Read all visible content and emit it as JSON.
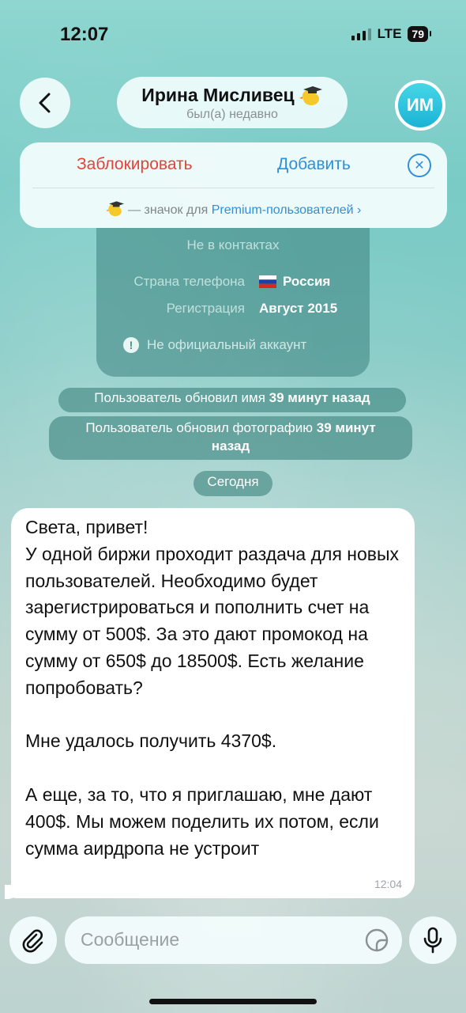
{
  "status": {
    "time": "12:07",
    "network": "LTE",
    "battery": "79"
  },
  "header": {
    "name": "Ирина Мисливец",
    "last_seen": "был(а) недавно",
    "avatar_initials": "ИМ"
  },
  "actions": {
    "block": "Заблокировать",
    "add": "Добавить",
    "premium_prefix": "— значок для",
    "premium_link": "Premium-пользователей ›"
  },
  "info_card": {
    "not_in_contacts": "Не в контактах",
    "phone_country_label": "Страна телефона",
    "phone_country_value": "Россия",
    "registration_label": "Регистрация",
    "registration_value": "Август 2015",
    "official_note": "Не официальный аккаунт"
  },
  "service_messages": {
    "name_update_text": "Пользователь обновил имя",
    "name_update_time": "39 минут назад",
    "photo_update_text": "Пользователь обновил фотографию",
    "photo_update_time_1": "39 минут",
    "photo_update_time_2": "назад",
    "date_separator": "Сегодня"
  },
  "message": {
    "text": "Света, привет!\nУ одной биржи проходит раздача для новых пользователей. Необходимо будет зарегистрироваться и пополнить счет на сумму от 500$. За это дают промокод на сумму от 650$ до 18500$. Есть желание попробовать?\n\nМне удалось получить 4370$.\n\nА еще, за то, что я приглашаю, мне дают 400$. Мы можем поделить их потом, если сумма аирдропа не устроит",
    "time": "12:04"
  },
  "composer": {
    "placeholder": "Сообщение"
  },
  "colors": {
    "accent": "#2f8fd8",
    "danger": "#e0453a",
    "avatar": "#1bb3d6"
  },
  "icons": [
    "back-arrow-icon",
    "graduate-duck-emoji-icon",
    "close-circle-icon",
    "russia-flag-icon",
    "info-icon",
    "paperclip-icon",
    "sticker-icon",
    "microphone-icon"
  ]
}
